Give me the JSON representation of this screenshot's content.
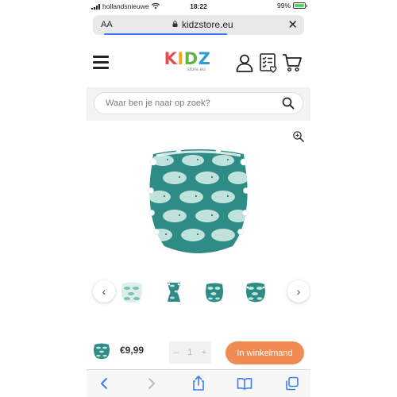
{
  "status_bar": {
    "carrier": "hollandsnieuwe",
    "time": "18:22",
    "battery": "99%",
    "battery_level": 0.99,
    "icons": [
      "signal-icon",
      "wifi-icon",
      "battery-icon"
    ]
  },
  "browser": {
    "text_size_label": "AA",
    "url": "kidzstore.eu",
    "page_load_progress": 0.65,
    "icons": [
      "lock-icon",
      "close-icon"
    ]
  },
  "header": {
    "logo_letters": [
      "K",
      "I",
      "D",
      "Z"
    ],
    "logo_sub": "store.eu",
    "logo_colors": [
      "#e84d4f",
      "#f0a81b",
      "#65b346",
      "#2f9bd6"
    ],
    "icons": [
      "menu-icon",
      "account-icon",
      "wishlist-icon",
      "cart-icon"
    ]
  },
  "search": {
    "placeholder": "Waar ben je naar op zoek?",
    "icon": "search-icon"
  },
  "product": {
    "image": "teal whale-print swim diaper",
    "zoom_icon": "zoom-in-icon",
    "thumbnail_count": 4,
    "prev_arrow": "‹",
    "next_arrow": "›"
  },
  "purchase_bar": {
    "price": "€9,99",
    "qty_minus": "–",
    "quantity": "1",
    "qty_plus": "+",
    "add_to_cart_label": "In winkelmand",
    "button_color": "#f08c53"
  },
  "safari_toolbar": {
    "icons": [
      "back-icon",
      "forward-icon",
      "share-icon",
      "bookmarks-icon",
      "tabs-icon"
    ]
  },
  "colors": {
    "diaper_teal": "#2f8b86",
    "whale_light": "#bfe2dc",
    "accent_blue": "#3b7cf6"
  }
}
